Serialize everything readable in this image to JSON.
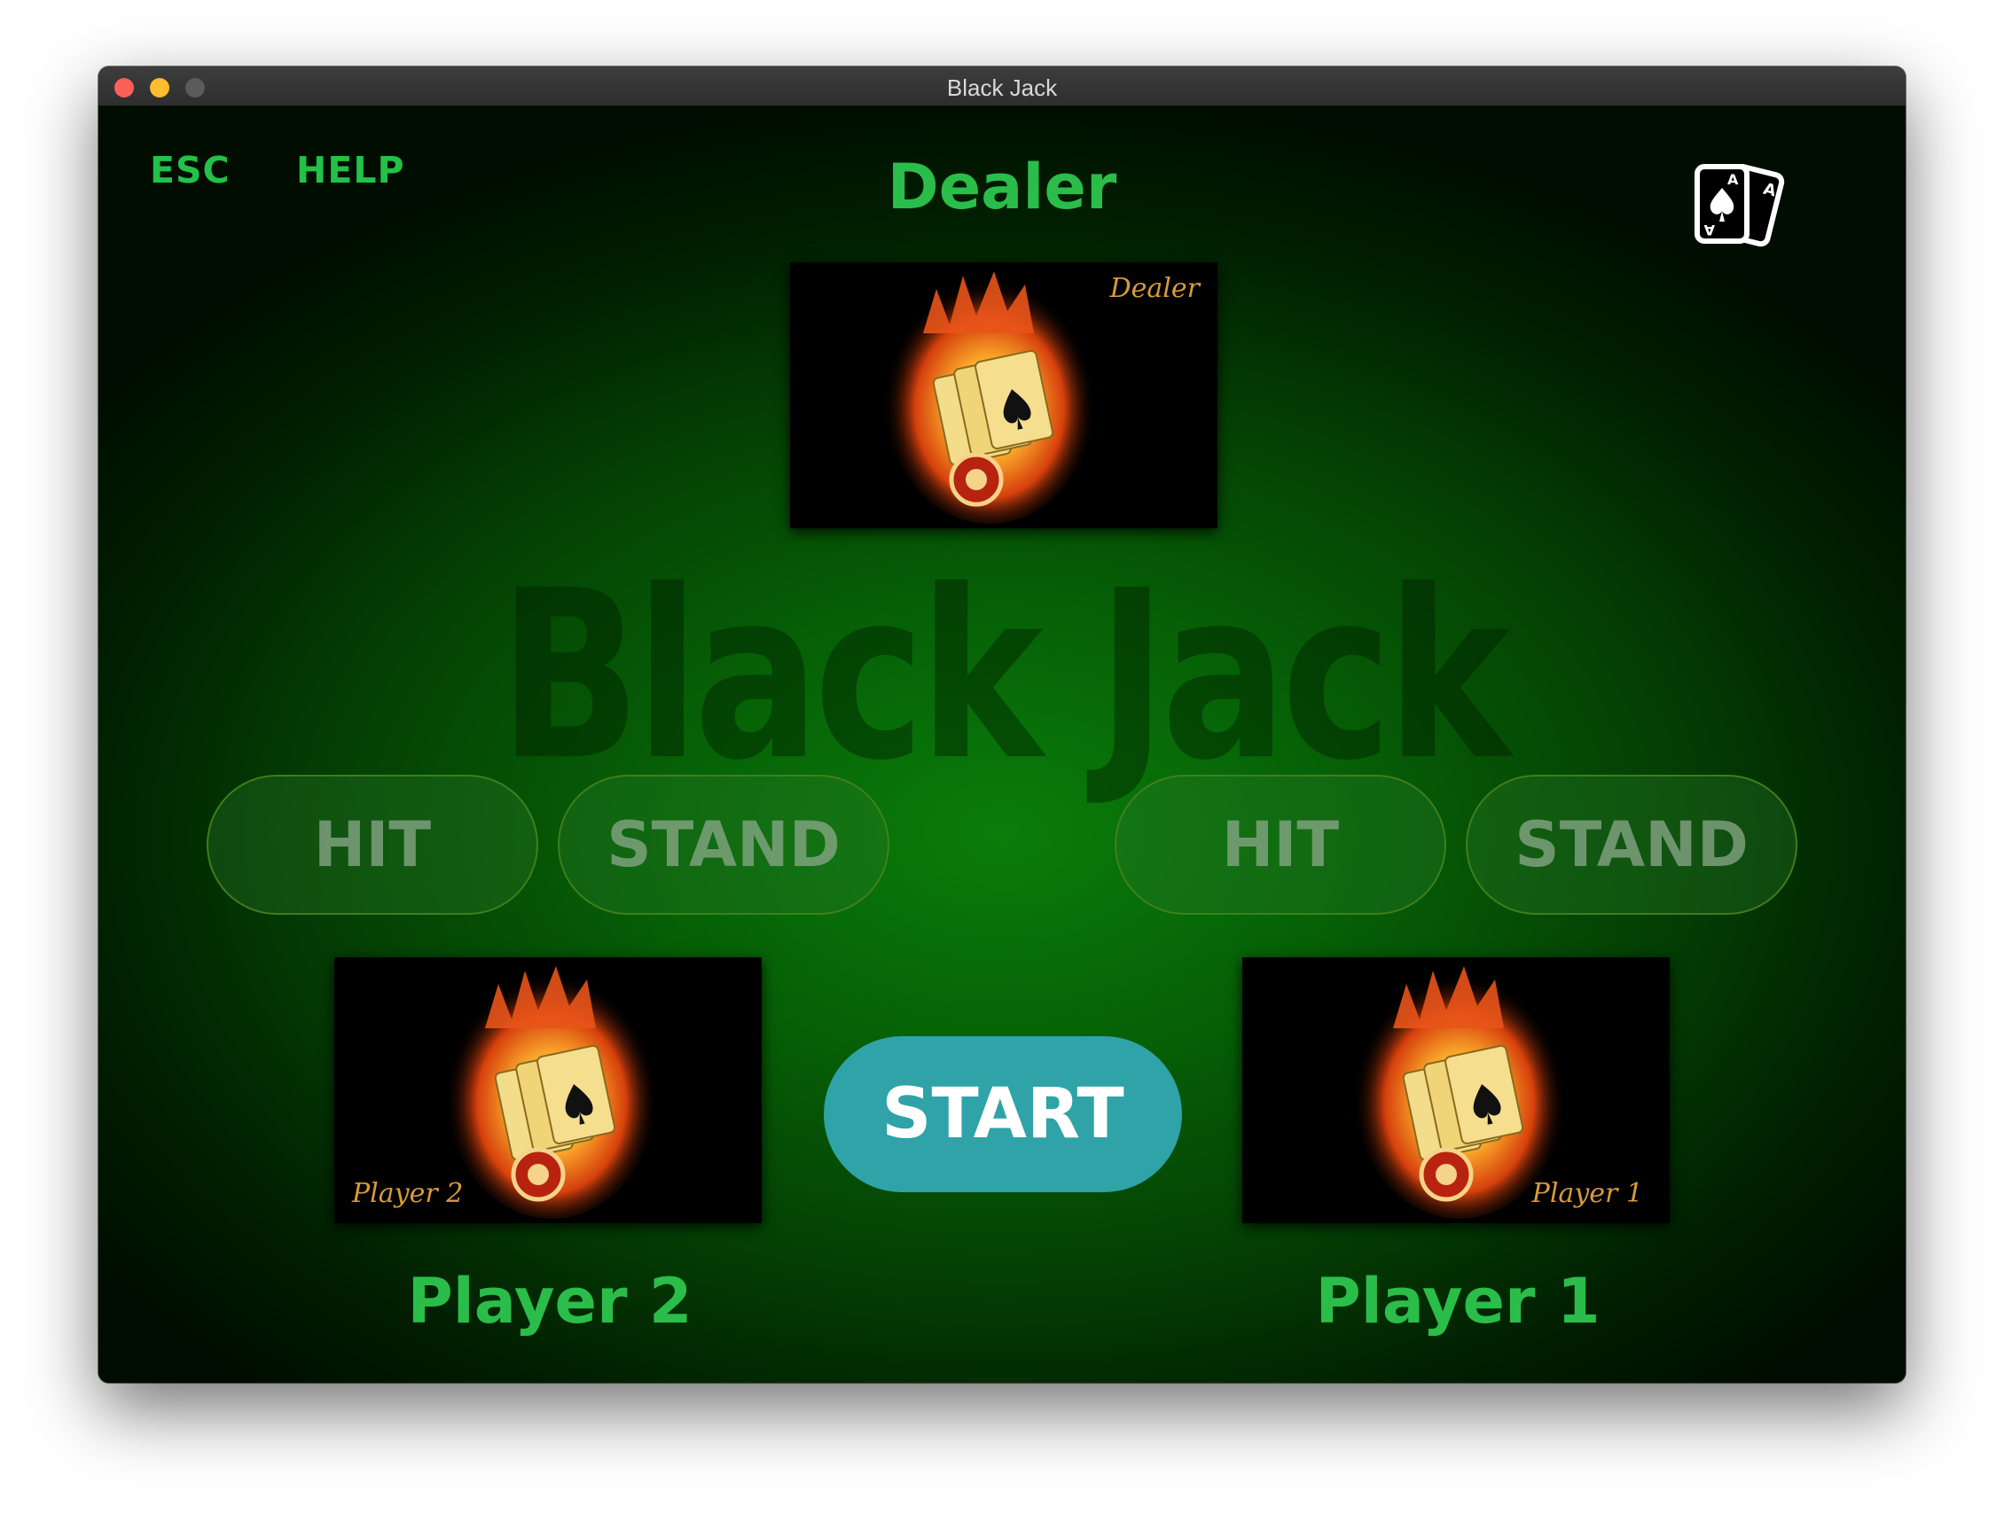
{
  "window": {
    "title": "Black Jack"
  },
  "nav": {
    "esc_label": "ESC",
    "help_label": "HELP",
    "cards_icon": "playing-cards-icon"
  },
  "dealer": {
    "title": "Dealer",
    "card_label": "Dealer"
  },
  "watermark": "Black Jack",
  "player2": {
    "title": "Player 2",
    "card_label": "Player 2",
    "hit_label": "HIT",
    "stand_label": "STAND"
  },
  "player1": {
    "title": "Player 1",
    "card_label": "Player 1",
    "hit_label": "HIT",
    "stand_label": "STAND"
  },
  "start_label": "START",
  "colors": {
    "accent_green": "#2bbd4a",
    "start_button": "#2fa3a8",
    "table_green": "#066106"
  }
}
